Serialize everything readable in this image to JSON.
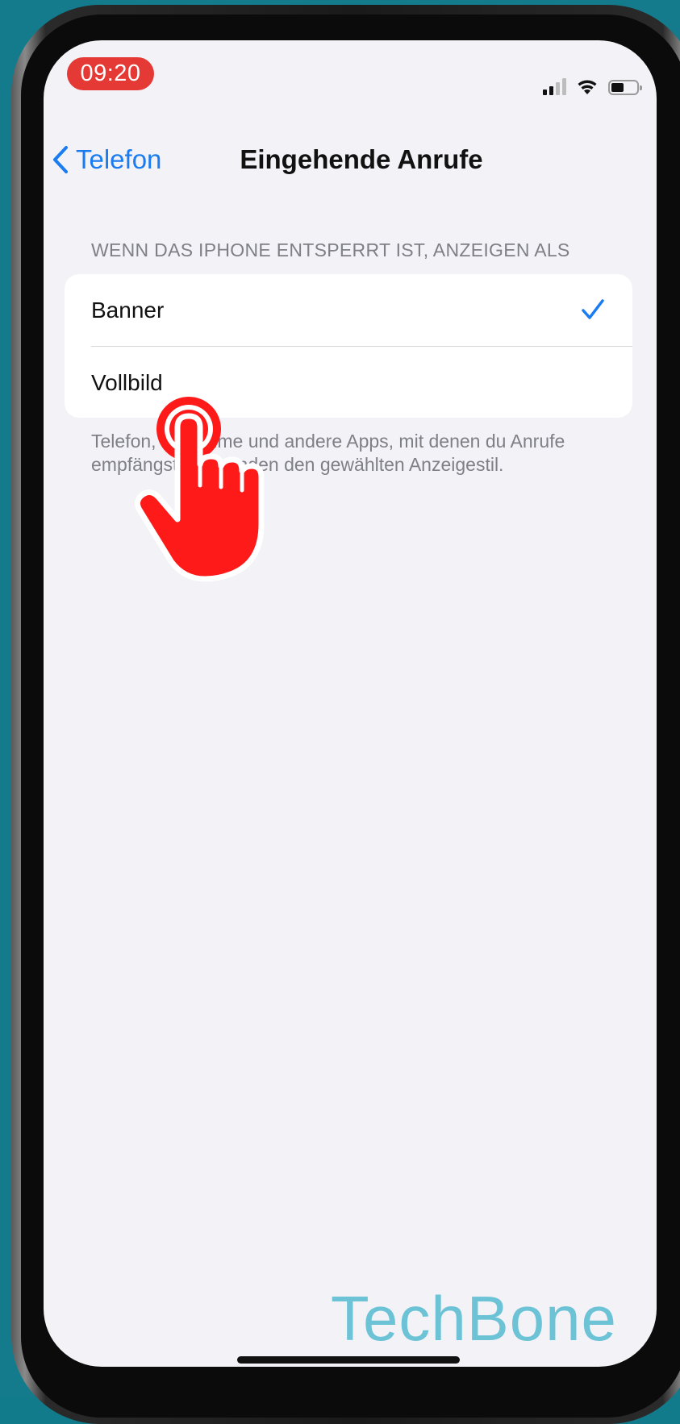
{
  "status_bar": {
    "time": "09:20",
    "icons": [
      "cellular-signal-icon",
      "wifi-icon",
      "battery-icon"
    ]
  },
  "nav": {
    "back_label": "Telefon",
    "title": "Eingehende Anrufe"
  },
  "section": {
    "header": "WENN DAS IPHONE ENTSPERRT IST, ANZEIGEN ALS",
    "options": [
      {
        "label": "Banner",
        "selected": true
      },
      {
        "label": "Vollbild",
        "selected": false
      }
    ],
    "footer": "Telefon, FaceTime und andere Apps, mit denen du Anrufe empfängst, verwenden den gewählten Anzeigestil."
  },
  "watermark": "TechBone",
  "colors": {
    "accent": "#1a7cf0",
    "tap_indicator": "#ff1a1a",
    "watermark": "#6cc3d6",
    "time_pill": "#e53935"
  }
}
